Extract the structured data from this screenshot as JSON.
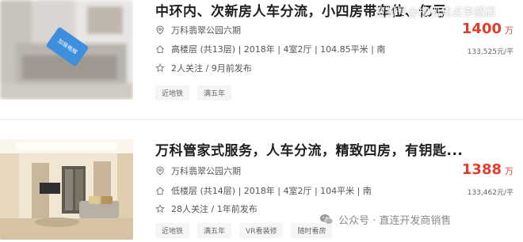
{
  "listings": [
    {
      "title": "中环内、次新房人车分流，小四房带车位、亿亏",
      "community": "万科翡翠公园六期",
      "details": "高楼层 (共13层) | 2018年 | 4室2厅 | 104.85平米 | 南",
      "followers": "2人关注 / 9月前发布",
      "price": "1400",
      "price_unit": "万",
      "unit_price": "133,525元/平",
      "tags": [
        "近地铁",
        "满五年"
      ],
      "thumb_badge": "加装电梯"
    },
    {
      "title": "万科管家式服务，人车分流，精致四房，有钥匙...",
      "community": "万科翡翠公园六期",
      "details": "低楼层 (共14层) | 2018年 | 4室2厅 | 104平米 | 南",
      "followers": "28人关注 / 1年前发布",
      "price": "1388",
      "price_unit": "万",
      "unit_price": "133,462元/平",
      "tags": [
        "近地铁",
        "满五年",
        "VR看装修",
        "随时看房"
      ]
    }
  ],
  "watermarks": {
    "top": "搜狐号@搜狐焦点李感店",
    "bottom": "公众号 · 直连开发商销售"
  },
  "colors": {
    "price": "#e23c2a",
    "tag_bg": "#f4f5f7"
  },
  "icons": [
    "location-icon",
    "house-icon",
    "star-icon",
    "wechat-icon"
  ]
}
